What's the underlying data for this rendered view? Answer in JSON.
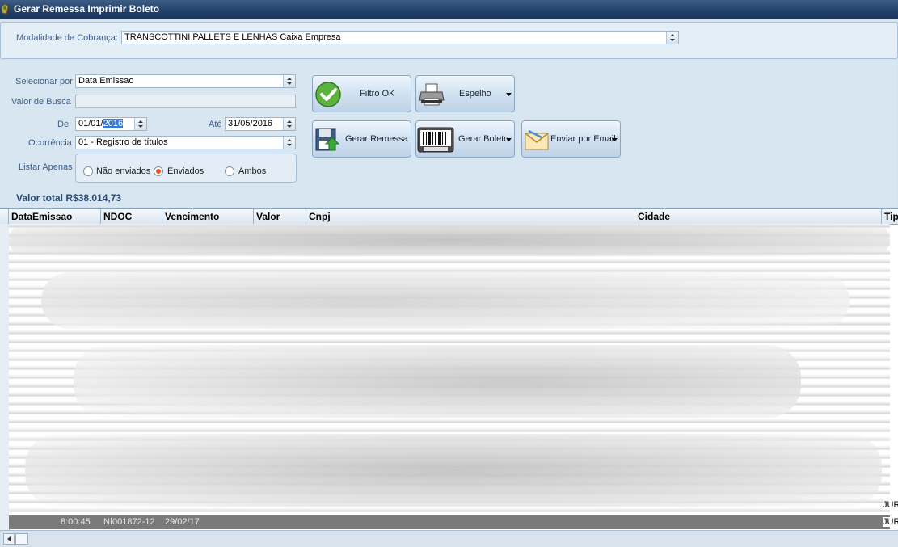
{
  "window": {
    "title": "Gerar Remessa Imprimir Boleto"
  },
  "modalidade": {
    "label": "Modalidade de Cobrança:",
    "value": "TRANSCOTTINI PALLETS E LENHAS Caixa Empresa"
  },
  "filters": {
    "selecionar_por": {
      "label": "Selecionar por",
      "value": "Data Emissao"
    },
    "valor_busca": {
      "label": "Valor de Busca",
      "value": ""
    },
    "de": {
      "label": "De",
      "value_prefix": "01/01/",
      "value_selected": "2016"
    },
    "ate": {
      "label": "Até",
      "value": "31/05/2016"
    },
    "ocorrencia": {
      "label": "Ocorrência",
      "value": "01 - Registro de títulos"
    },
    "listar_apenas": {
      "label": "Listar Apenas",
      "options": [
        "Não enviados",
        "Enviados",
        "Ambos"
      ],
      "selected": "Enviados"
    }
  },
  "buttons": {
    "filtro_ok": "Filtro OK",
    "espelho": "Espelho",
    "gerar_remessa": "Gerar Remessa",
    "gerar_boleto": "Gerar Boleto",
    "enviar_email": "Enviar por Email"
  },
  "total": "Valor total R$38.014,73",
  "grid": {
    "columns": [
      "DataEmissao",
      "NDOC",
      "Vencimento",
      "Valor",
      "Cnpj",
      "Cidade",
      "Tip"
    ],
    "last_row": {
      "time": "8:00:45",
      "ndoc": "Nf001872-12",
      "venc": "29/02/17"
    },
    "side_values": [
      "JUR",
      "JUR",
      "JUR"
    ]
  },
  "colors": {
    "accent": "#22406a",
    "radio_selected": "#e2561f"
  },
  "icons": [
    "app-icon",
    "check-icon",
    "printer-icon",
    "floppy-save-icon",
    "barcode-boleto-icon",
    "email-icon"
  ]
}
